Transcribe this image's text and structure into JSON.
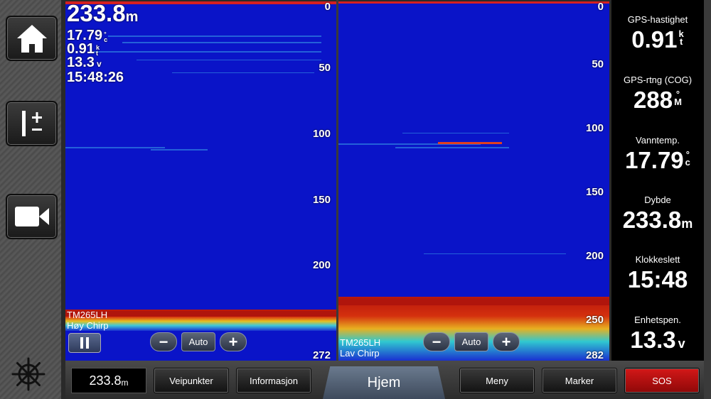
{
  "overlay": {
    "depth": "233.8",
    "depth_unit": "m",
    "temp": "17.79",
    "temp_unit_1": "°",
    "temp_unit_2": "c",
    "speed": "0.91",
    "speed_unit_1": "k",
    "speed_unit_2": "t",
    "voltage": "13.3",
    "voltage_unit": "v",
    "time": "15:48:26"
  },
  "left_pane": {
    "depth_scale": [
      "0",
      "50",
      "100",
      "150",
      "200",
      "272"
    ],
    "transducer": "TM265LH",
    "mode": "Høy Chirp",
    "auto_label": "Auto"
  },
  "right_pane": {
    "depth_scale": [
      "0",
      "50",
      "100",
      "150",
      "200",
      "250",
      "282"
    ],
    "transducer": "TM265LH",
    "mode": "Lav Chirp",
    "auto_label": "Auto"
  },
  "data_fields": [
    {
      "label": "GPS-hastighet",
      "value": "0.91",
      "unit_1": "k",
      "unit_2": "t"
    },
    {
      "label": "GPS-rtng (COG)",
      "value": "288",
      "unit_1": "°",
      "unit_2": "M"
    },
    {
      "label": "Vanntemp.",
      "value": "17.79",
      "unit_1": "°",
      "unit_2": "c"
    },
    {
      "label": "Dybde",
      "value": "233.8",
      "unit": "m"
    },
    {
      "label": "Klokkeslett",
      "value": "15:48"
    },
    {
      "label": "Enhetspen.",
      "value": "13.3",
      "unit": "v"
    }
  ],
  "bottombar": {
    "depth": "233.8",
    "depth_unit": "m",
    "waypoints": "Veipunkter",
    "info": "Informasjon",
    "home": "Hjem",
    "menu": "Meny",
    "marker": "Marker",
    "sos": "SOS"
  },
  "icons": [
    "home-icon",
    "zoom-range-icon",
    "camera-icon",
    "helm-icon",
    "pause-icon",
    "minus-icon",
    "plus-icon"
  ],
  "colors": {
    "sonar_water": "#0a14c8",
    "sos": "#d41818",
    "bottom_return": "#c41a10"
  }
}
